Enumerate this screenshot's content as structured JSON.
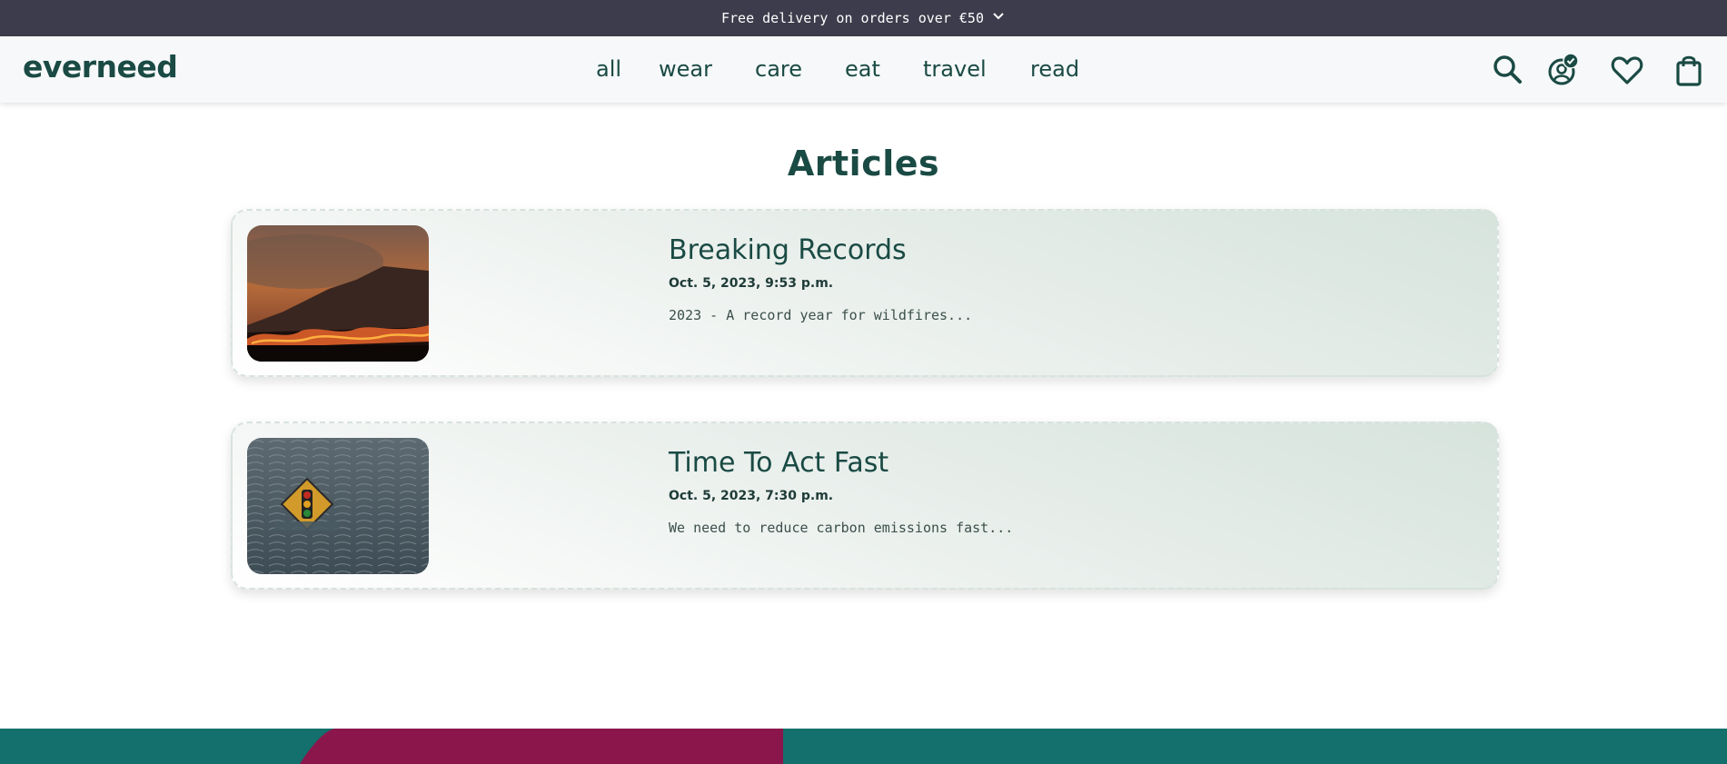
{
  "promo": {
    "text": "Free delivery on orders over €50",
    "icon": "chevron-down-icon"
  },
  "header": {
    "logo": "everneed",
    "nav": [
      "all",
      "wear",
      "care",
      "eat",
      "travel",
      "read"
    ],
    "icons": [
      "search-icon",
      "account-verified-icon",
      "heart-icon",
      "shopping-bag-icon"
    ]
  },
  "main": {
    "title": "Articles",
    "articles": [
      {
        "title": "Breaking Records",
        "date": "Oct. 5, 2023, 9:53 p.m.",
        "excerpt": "2023 - A record year for wildfires...",
        "image": "wildfire-photo"
      },
      {
        "title": "Time To Act Fast",
        "date": "Oct. 5, 2023, 7:30 p.m.",
        "excerpt": "We need to reduce carbon emissions fast...",
        "image": "flooded-traffic-sign-photo"
      }
    ]
  },
  "colors": {
    "brand": "#1a4a44",
    "promo_bg": "#3c3c4c",
    "header_bg": "#f6f8f9",
    "footer_teal": "#13706c",
    "footer_magenta": "#8b164c"
  }
}
